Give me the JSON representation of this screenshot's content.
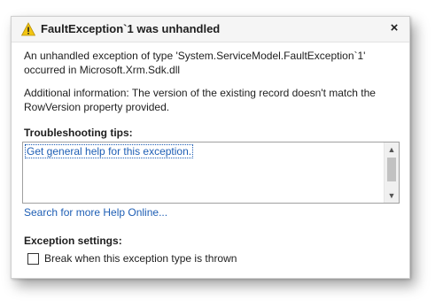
{
  "dialog": {
    "title": "FaultException`1 was unhandled",
    "title_icon": "warning-icon",
    "close_glyph": "×",
    "message_line1": "An unhandled exception of type 'System.ServiceModel.FaultException`1' occurred in Microsoft.Xrm.Sdk.dll",
    "message_line2": "Additional information: The version of the existing record doesn't match the RowVersion property provided."
  },
  "troubleshooting": {
    "heading": "Troubleshooting tips:",
    "tips": [
      "Get general help for this exception."
    ]
  },
  "help_online_link": "Search for more Help Online...",
  "exception_settings": {
    "heading": "Exception settings:",
    "checkbox_label": "Break when this exception type is thrown",
    "checked": false
  },
  "colors": {
    "link": "#1f5fb5",
    "warning": "#f2c511"
  }
}
